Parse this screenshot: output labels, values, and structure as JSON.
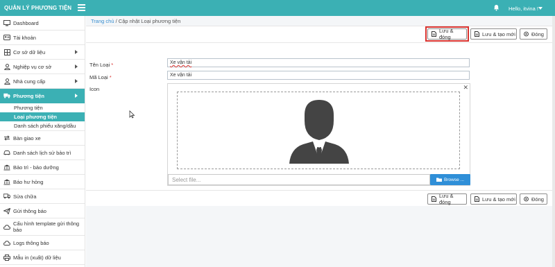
{
  "header": {
    "brand": "QUẢN LÝ PHƯƠNG TIỆN",
    "greeting": "Hello, itvina !",
    "bg_color": "#3bb0b4"
  },
  "sidebar": {
    "items": [
      {
        "label": "Dashboard",
        "icon": "monitor-icon"
      },
      {
        "label": "Tài khoản",
        "icon": "user-card-icon"
      },
      {
        "label": "Cơ sở dữ liệu",
        "icon": "table-icon",
        "has_children": true
      },
      {
        "label": "Nghiệp vụ cơ sở",
        "icon": "user-icon",
        "has_children": true
      },
      {
        "label": "Nhà cung cấp",
        "icon": "user-icon",
        "has_children": true
      },
      {
        "label": "Phương tiện",
        "icon": "truck-icon",
        "has_children": true,
        "active": true
      }
    ],
    "sub_items": [
      {
        "label": "Phương tiện"
      },
      {
        "label": "Loại phương tiện",
        "active": true
      },
      {
        "label": "Danh sách phiếu xăng/dầu"
      }
    ],
    "items_after": [
      {
        "label": "Bàn giao xe",
        "icon": "exchange-icon"
      },
      {
        "label": "Danh sách lịch sử bảo trì",
        "icon": "car-icon"
      },
      {
        "label": "Bảo trì - bảo dưỡng",
        "icon": "bank-icon"
      },
      {
        "label": "Báo hư hỏng",
        "icon": "bank-icon"
      },
      {
        "label": "Sửa chữa",
        "icon": "truck-icon"
      },
      {
        "label": "Gửi thông báo",
        "icon": "send-icon"
      },
      {
        "label": "Cấu hình template gửi thông báo",
        "icon": "cloud-icon"
      },
      {
        "label": "Logs thông báo",
        "icon": "cloud-icon"
      },
      {
        "label": "Mẫu in (xuất) dữ liệu",
        "icon": "print-icon"
      }
    ]
  },
  "breadcrumb": {
    "home": "Trang chủ",
    "separator": "/",
    "current": "Cập nhật Loại phương tiện"
  },
  "toolbar": {
    "save_close": "Lưu & đóng",
    "save_new": "Lưu & tạo mới",
    "close": "Đóng"
  },
  "form": {
    "ten_loai_label": "Tên Loại",
    "ten_loai_value": "Xe vận tải",
    "ma_loai_label": "Mã Loại",
    "ma_loai_value": "Xe vận tải",
    "icon_label": "Icon",
    "required_mark": "*",
    "file_placeholder": "Select file...",
    "browse_label": "Browse ..."
  },
  "colors": {
    "accent": "#3bb0b4",
    "highlight": "#d9332f",
    "browse": "#2f8fd8"
  }
}
